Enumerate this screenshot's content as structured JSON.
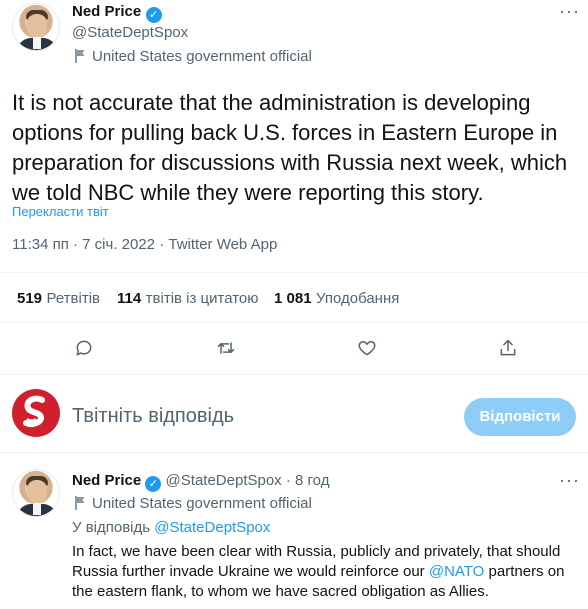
{
  "main_tweet": {
    "author_name": "Ned Price",
    "handle": "@StateDeptSpox",
    "label": "United States government official",
    "text": "It is not accurate that the administration is developing options for pulling back U.S. forces in Eastern Europe in preparation for discussions with Russia next week, which we told NBC while they were reporting this story.",
    "translate_link": "Перекласти твіт",
    "timestamp": "11:34 пп · 7 січ. 2022 · Twitter Web App",
    "stats": [
      {
        "num": "519",
        "label": "Ретвітів"
      },
      {
        "num": "114",
        "label": "твітів із цитатою"
      },
      {
        "num": "1 081",
        "label": "Уподобання"
      }
    ],
    "actions": [
      "reply-icon",
      "retweet-icon",
      "like-icon",
      "share-icon"
    ]
  },
  "composer": {
    "placeholder": "Твітніть відповідь",
    "button_label": "Відповісти",
    "button_color": "#8ecdf8"
  },
  "reply_tweet": {
    "author_name": "Ned Price",
    "handle": "@StateDeptSpox",
    "time": "8 год",
    "label": "United States government official",
    "replying_prefix": "У відповідь",
    "replying_handle": "@StateDeptSpox",
    "text_part1": "In fact, we have been clear with Russia, publicly and privately, that should Russia further invade Ukraine we would reinforce our",
    "mention": "@NATO",
    "text_part2": "partners on the eastern flank, to whom we have sacred obligation as Allies."
  },
  "colors": {
    "accent": "#1d9bf0",
    "muted": "#536471",
    "text": "#0f1419",
    "avatar_brand": "#d0202e"
  }
}
